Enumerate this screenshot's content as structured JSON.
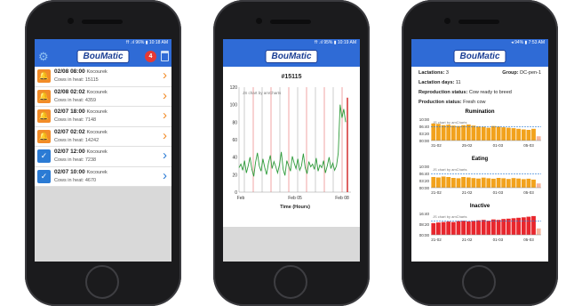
{
  "brand": {
    "logo_text": "BouMatic",
    "accent_color": "#2f6bd6",
    "alert_color": "#f28c28"
  },
  "phone1": {
    "status": "⇈ .ıl 96% ▮ 10:18 AM",
    "badge_count": "4",
    "alerts": [
      {
        "icon": "bell-icon",
        "time": "02/08 08:00",
        "user": "Kocourek",
        "detail": "Cows in heat: 15115",
        "type": "alert"
      },
      {
        "icon": "bell-icon",
        "time": "02/08 02:02",
        "user": "Kocourek",
        "detail": "Cows in heat: 4359",
        "type": "alert"
      },
      {
        "icon": "bell-icon",
        "time": "02/07 18:00",
        "user": "Kocourek",
        "detail": "Cows in heat: 7148",
        "type": "alert"
      },
      {
        "icon": "bell-icon",
        "time": "02/07 02:02",
        "user": "Kocourek",
        "detail": "Cows in heat: 14242",
        "type": "alert"
      },
      {
        "icon": "check-icon",
        "time": "02/07 12:00",
        "user": "Kocourek",
        "detail": "Cows in heat: 7238",
        "type": "check"
      },
      {
        "icon": "check-icon",
        "time": "02/07 10:00",
        "user": "Kocourek",
        "detail": "Cows in heat: 4670",
        "type": "check"
      }
    ]
  },
  "phone2": {
    "status": "⇈ .ıl 95% ▮ 10:19 AM",
    "chart_data": {
      "type": "line",
      "title": "#15115",
      "xlabel": "Time (Hours)",
      "ylabel": "",
      "credit": "JS chart by amCharts",
      "x_ticks": [
        "Feb",
        "Feb 05",
        "Feb 08"
      ],
      "y_ticks": [
        0,
        20,
        40,
        60,
        80,
        100,
        120
      ],
      "ylim": [
        0,
        120
      ],
      "series": [
        {
          "values": [
            28,
            32,
            25,
            36,
            22,
            30,
            40,
            26,
            18,
            34,
            45,
            30,
            24,
            38,
            28,
            20,
            33,
            42,
            27,
            35,
            29,
            22,
            31,
            46,
            26,
            19,
            36,
            30,
            24,
            41,
            33,
            27,
            38,
            25,
            30,
            44,
            28,
            21,
            35,
            29,
            32,
            26,
            39,
            24,
            31,
            28,
            36,
            22,
            30,
            40,
            27,
            33,
            25,
            30,
            45,
            100,
            85,
            95,
            80
          ]
        }
      ]
    }
  },
  "phone3": {
    "status": "◂ 94% ▮ 7:53 AM",
    "lactations_label": "Lactations:",
    "lactations_value": "3",
    "group_label": "Group:",
    "group_value": "DC-pen-1",
    "lact_days_label": "Lactation days:",
    "lact_days_value": "11",
    "repro_label": "Reproduction status:",
    "repro_value": "Cow ready to breed",
    "prod_label": "Production status:",
    "prod_value": "Fresh cow",
    "charts": [
      {
        "title": "Rumination",
        "credit": "JS chart by amCharts",
        "y_ticks": [
          "10:00",
          "06:40",
          "03:20",
          "00:00"
        ],
        "x_ticks": [
          "31-02",
          "25-02",
          "01-03",
          "05-03"
        ],
        "values": [
          0.8,
          0.78,
          0.72,
          0.74,
          0.7,
          0.68,
          0.72,
          0.75,
          0.7,
          0.66,
          0.64,
          0.6,
          0.68,
          0.65,
          0.62,
          0.6,
          0.58,
          0.55,
          0.52,
          0.5,
          0.55,
          0.2
        ],
        "color": "#f2a21c"
      },
      {
        "title": "Eating",
        "credit": "JS chart by amCharts",
        "y_ticks": [
          "10:00",
          "06:40",
          "03:20",
          "00:00"
        ],
        "x_ticks": [
          "21-02",
          "21-02",
          "01-03",
          "05-03"
        ],
        "values": [
          0.5,
          0.48,
          0.52,
          0.5,
          0.46,
          0.44,
          0.5,
          0.48,
          0.45,
          0.43,
          0.47,
          0.44,
          0.42,
          0.46,
          0.44,
          0.41,
          0.45,
          0.43,
          0.4,
          0.42,
          0.38,
          0.2
        ],
        "color": "#f2a21c"
      },
      {
        "title": "Inactive",
        "credit": "JS chart by amCharts",
        "y_ticks": [
          "16:40",
          "08:20",
          "00:00"
        ],
        "x_ticks": [
          "21-02",
          "21-02",
          "01-03",
          "05-03"
        ],
        "values": [
          0.55,
          0.58,
          0.6,
          0.62,
          0.6,
          0.64,
          0.66,
          0.63,
          0.65,
          0.68,
          0.7,
          0.66,
          0.72,
          0.7,
          0.74,
          0.76,
          0.78,
          0.8,
          0.82,
          0.85,
          0.88,
          0.3
        ],
        "color": "#e8262d"
      }
    ]
  }
}
